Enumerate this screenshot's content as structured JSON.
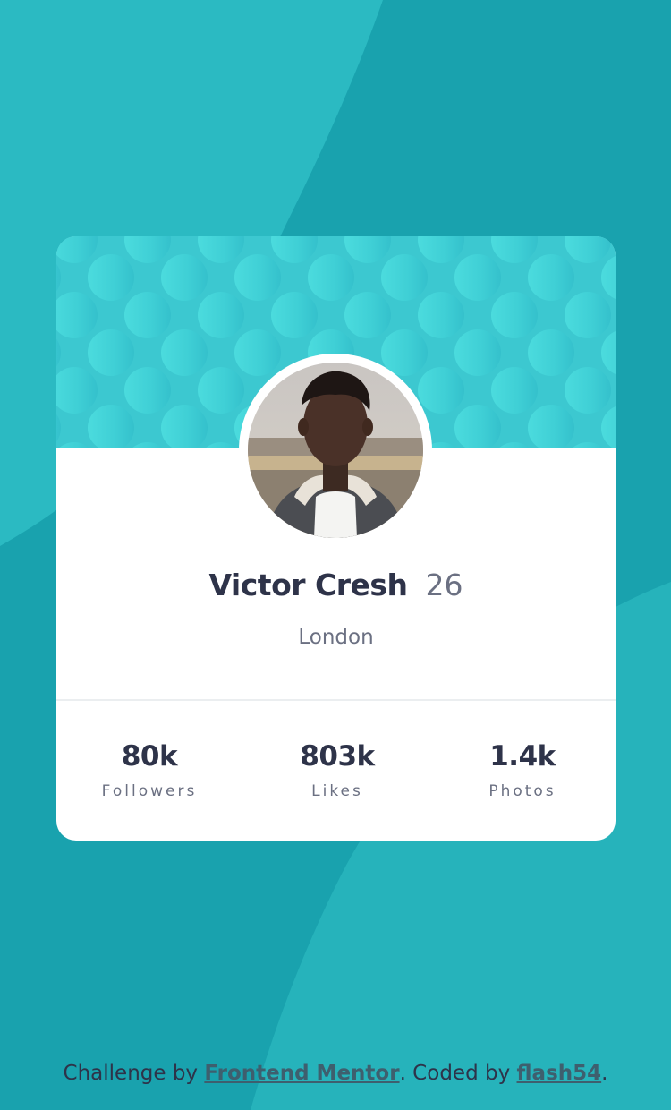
{
  "profile": {
    "name": "Victor Cresh",
    "age": "26",
    "location": "London"
  },
  "stats": [
    {
      "value": "80k",
      "label": "Followers"
    },
    {
      "value": "803k",
      "label": "Likes"
    },
    {
      "value": "1.4k",
      "label": "Photos"
    }
  ],
  "attribution": {
    "prefix": "Challenge by ",
    "link1": "Frontend Mentor",
    "middle": ". Coded by ",
    "link2": "flash54",
    "suffix": "."
  },
  "colors": {
    "background": "#19a2ae",
    "background_light": "#2bbac2",
    "header": "#3fc9d0",
    "card": "#ffffff",
    "text_dark": "#2e3349",
    "text_gray": "#6b7082"
  }
}
